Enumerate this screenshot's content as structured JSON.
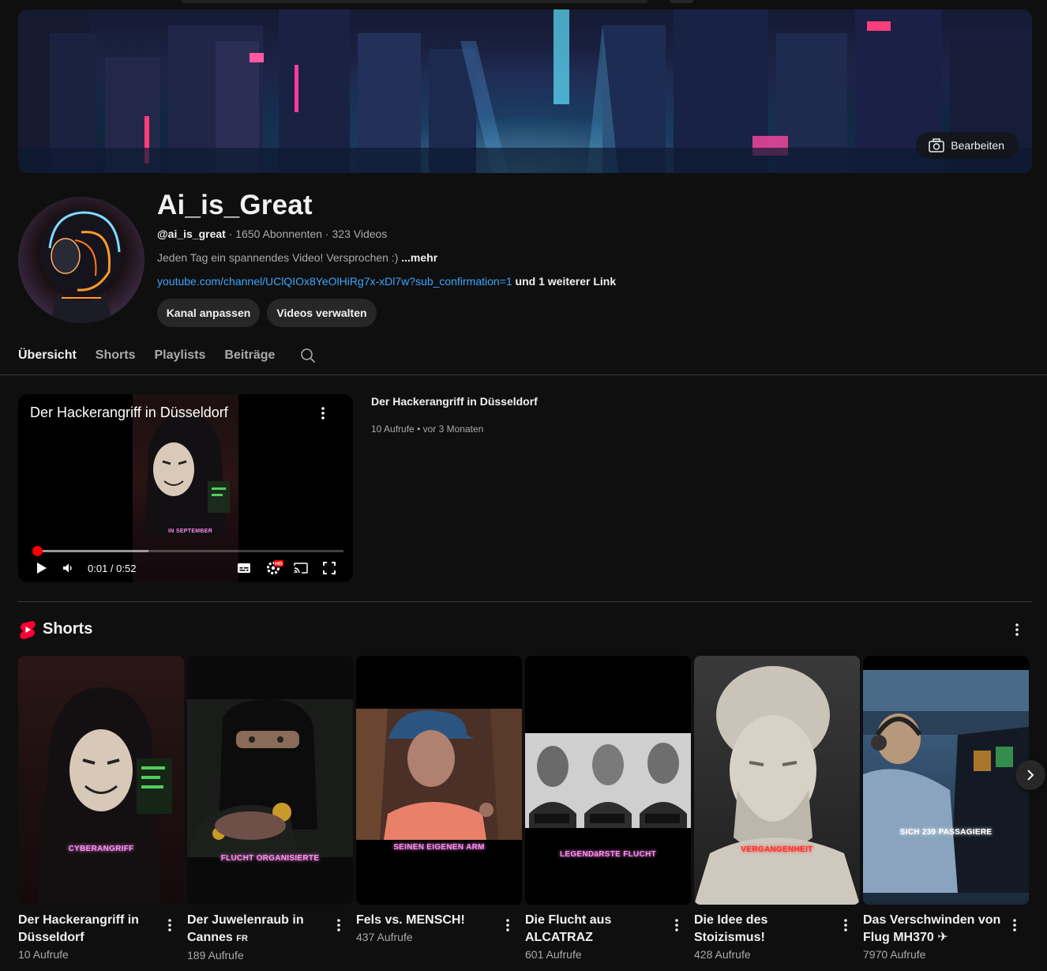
{
  "banner": {
    "edit_label": "Bearbeiten"
  },
  "channel": {
    "name": "Ai_is_Great",
    "handle": "@ai_is_great",
    "subscribers": "1650 Abonnenten",
    "videos": "323 Videos",
    "separator": " · ",
    "description": "Jeden Tag ein spannendes Video! Versprochen :)",
    "more_label": "...mehr",
    "link_url": "youtube.com/channel/UClQIOx8YeOlHiRg7x-xDl7w?sub_confirmation=1",
    "link_extra": "und 1 weiterer Link",
    "buttons": {
      "customize": "Kanal anpassen",
      "manage": "Videos verwalten"
    }
  },
  "tabs": [
    "Übersicht",
    "Shorts",
    "Playlists",
    "Beiträge"
  ],
  "featured": {
    "title": "Der Hackerangriff in Düsseldorf",
    "views": "10 Aufrufe",
    "age": "vor 3 Monaten",
    "dot": "•",
    "caption": "IN SEPTEMBER",
    "time": "0:01 / 0:52",
    "progress_played": 0.01,
    "progress_loaded": 0.37,
    "hd_badge": "HD"
  },
  "shorts": {
    "title": "Shorts",
    "items": [
      {
        "title": "Der Hackerangriff in Düsseldorf",
        "views": "10 Aufrufe",
        "caption": "CYBERANGRIFF",
        "caption_color": "#ff8cf0"
      },
      {
        "title": "Der Juwelenraub in Cannes",
        "title_suffix": "FR",
        "views": "189 Aufrufe",
        "caption": "FLUCHT ORGANISIERTE",
        "caption_color": "#ff8cf0"
      },
      {
        "title": "Fels vs. MENSCH!",
        "views": "437 Aufrufe",
        "caption": "SEINEN EIGENEN ARM",
        "caption_color": "#ff8cf0"
      },
      {
        "title": "Die Flucht aus ALCATRAZ",
        "views": "601 Aufrufe",
        "caption": "LEGENDäRSTE FLUCHT",
        "caption_color": "#ff8cf0"
      },
      {
        "title": "Die Idee des Stoizismus!",
        "views": "428 Aufrufe",
        "caption": "VERGANGENHEIT",
        "caption_color": "#ff2a2a"
      },
      {
        "title": "Das Verschwinden von Flug MH370",
        "title_suffix": "✈",
        "views": "7970 Aufrufe",
        "caption": "SICH 239 PASSAGIERE",
        "caption_color": "#ffffff"
      }
    ]
  },
  "icons": {
    "camera": "camera-icon",
    "search": "search-icon",
    "kebab": "more-vert-icon",
    "play": "play-icon",
    "volume": "volume-icon",
    "subtitles": "subtitles-icon",
    "settings": "settings-icon",
    "cast": "cast-icon",
    "fullscreen": "fullscreen-icon",
    "shorts": "shorts-logo-icon",
    "next": "chevron-right-icon"
  }
}
